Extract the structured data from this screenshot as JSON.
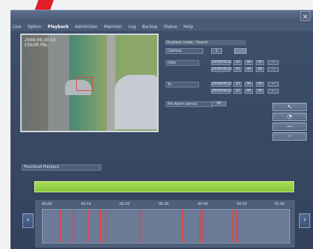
{
  "menu": {
    "items": [
      {
        "label": "Live"
      },
      {
        "label": "Option"
      },
      {
        "label": "Playback"
      },
      {
        "label": "Administer"
      },
      {
        "label": "Maintain"
      },
      {
        "label": "Log"
      },
      {
        "label": "Backup"
      },
      {
        "label": "Status"
      },
      {
        "label": "Help"
      }
    ],
    "active_index": 2
  },
  "window": {
    "close_label": "×"
  },
  "video": {
    "timestamp": "2008-06-20 10",
    "mode": "COLOR PAL"
  },
  "playback": {
    "panel_title": "Playback mode / Search",
    "select_value": "Camera",
    "thumbnail_label": "Thumbnail Playback",
    "rows": [
      {
        "label": "Date",
        "cells": [
          "2008/06/20",
          "10",
          "00",
          "00",
          "--"
        ]
      },
      {
        "label": "",
        "cells": [
          "2008/06/20",
          "10",
          "00",
          "00",
          "--"
        ]
      },
      {
        "label": "To",
        "cells": [
          "2008/06/20",
          "10",
          "00",
          "00",
          "--"
        ]
      },
      {
        "label": "",
        "cells": [
          "2008/06/20",
          "10",
          "00",
          "00",
          "--"
        ]
      },
      {
        "label": "Pre-Alarm period",
        "cells": [
          "30"
        ]
      }
    ],
    "right_buttons": [
      {
        "label": "↖"
      },
      {
        "label": "◔"
      },
      {
        "label": "—"
      },
      {
        "label": "›"
      }
    ],
    "spin_value": "1"
  },
  "timeline": {
    "ticks": [
      "00:00",
      "00:10",
      "00:20",
      "00:30",
      "00:40",
      "00:50",
      "01:00"
    ],
    "events": [
      0.07,
      0.12,
      0.18,
      0.23,
      0.25,
      0.39,
      0.56,
      0.63,
      0.64,
      0.76,
      0.78
    ]
  }
}
